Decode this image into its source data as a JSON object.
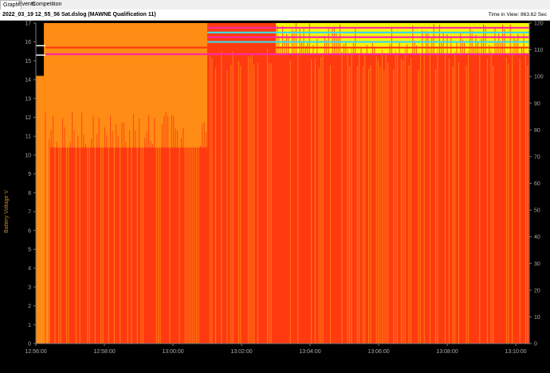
{
  "tabs": [
    {
      "label": "Graph",
      "active": true
    },
    {
      "label": "Events",
      "active": false
    },
    {
      "label": "Competition",
      "active": false
    }
  ],
  "title": "2022_03_19 12_55_56 Sat.dslog (MAWNE Qualification 11)",
  "time_in_view": "Time in View: 863.62 Sec",
  "colors": {
    "background": "#000000",
    "primary_trace": "#ff3a10",
    "secondary_trace": "#ff8c14",
    "highlight": "#f5f50a",
    "cyan_line": "#3fd8e8",
    "magenta_line": "#ff2aa0",
    "axis_text": "#aaaaaa"
  },
  "chart_data": {
    "type": "area",
    "title": "",
    "ylabel": "Battery Voltage V",
    "y_left_ticks": [
      "0",
      "1",
      "2",
      "3",
      "4",
      "5",
      "6",
      "7",
      "8",
      "9",
      "10",
      "11",
      "12",
      "13",
      "14",
      "15",
      "16",
      "17"
    ],
    "y_left_range": [
      0,
      17
    ],
    "y_right_ticks": [
      "0",
      "10",
      "20",
      "30",
      "40",
      "50",
      "60",
      "70",
      "80",
      "90",
      "100",
      "110",
      "120"
    ],
    "y_right_range": [
      0,
      120
    ],
    "x_ticks": [
      "12:56:00",
      "12:58:00",
      "13:00:00",
      "13:02:00",
      "13:04:00",
      "13:06:00",
      "13:08:00",
      "13:10:00"
    ],
    "x_range_seconds": [
      0,
      863.62
    ],
    "grid": false,
    "series": [
      {
        "role": "battery-voltage-start",
        "values": [
          14.2
        ]
      },
      {
        "role": "dense-trace-auto",
        "level": 10.4
      },
      {
        "role": "dense-trace-teleop",
        "level": 17
      }
    ],
    "status_lines_voltage": [
      16.75,
      16.5,
      16.25,
      16.0,
      15.7,
      15.35
    ]
  }
}
